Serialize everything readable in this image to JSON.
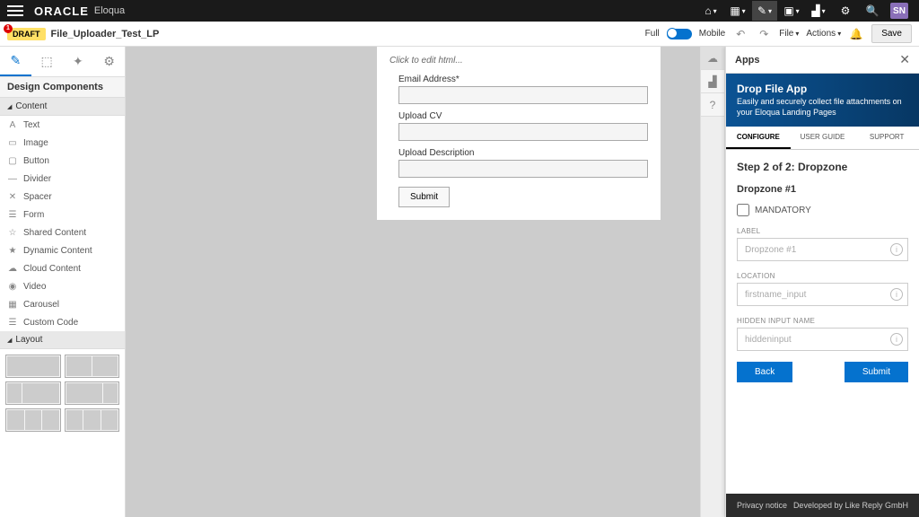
{
  "topbar": {
    "brand": "ORACLE",
    "product": "Eloqua",
    "user_initials": "SN"
  },
  "subbar": {
    "draft_label": "DRAFT",
    "draft_count": "1",
    "page_name": "File_Uploader_Test_LP",
    "full_label": "Full",
    "mobile_label": "Mobile",
    "file_menu": "File",
    "actions_menu": "Actions",
    "save_label": "Save"
  },
  "sidebar": {
    "panel_title": "Design Components",
    "content_header": "Content",
    "layout_header": "Layout",
    "items": [
      {
        "label": "Text",
        "icon": "A"
      },
      {
        "label": "Image",
        "icon": "▭"
      },
      {
        "label": "Button",
        "icon": "▢"
      },
      {
        "label": "Divider",
        "icon": "—"
      },
      {
        "label": "Spacer",
        "icon": "✕"
      },
      {
        "label": "Form",
        "icon": "☰"
      },
      {
        "label": "Shared Content",
        "icon": "☆"
      },
      {
        "label": "Dynamic Content",
        "icon": "★"
      },
      {
        "label": "Cloud Content",
        "icon": "☁"
      },
      {
        "label": "Video",
        "icon": "◉"
      },
      {
        "label": "Carousel",
        "icon": "▦"
      },
      {
        "label": "Custom Code",
        "icon": "☰"
      }
    ]
  },
  "canvas": {
    "edit_hint": "Click to edit html...",
    "fields": [
      {
        "label": "Email Address*"
      },
      {
        "label": "Upload CV"
      },
      {
        "label": "Upload Description"
      }
    ],
    "submit_label": "Submit"
  },
  "apps": {
    "header": "Apps",
    "hero_title": "Drop File App",
    "hero_desc": "Easily and securely collect file attachments on your Eloqua Landing Pages",
    "tabs": [
      "CONFIGURE",
      "USER GUIDE",
      "SUPPORT"
    ],
    "step_title": "Step 2 of 2: Dropzone",
    "dz_title": "Dropzone #1",
    "mandatory_label": "MANDATORY",
    "label_field": {
      "label": "LABEL",
      "placeholder": "Dropzone #1"
    },
    "location_field": {
      "label": "LOCATION",
      "placeholder": "firstname_input"
    },
    "hidden_field": {
      "label": "HIDDEN INPUT NAME",
      "placeholder": "hiddeninput"
    },
    "back_label": "Back",
    "submit_label": "Submit",
    "privacy_label": "Privacy notice",
    "developed_by": "Developed by Like Reply GmbH"
  }
}
